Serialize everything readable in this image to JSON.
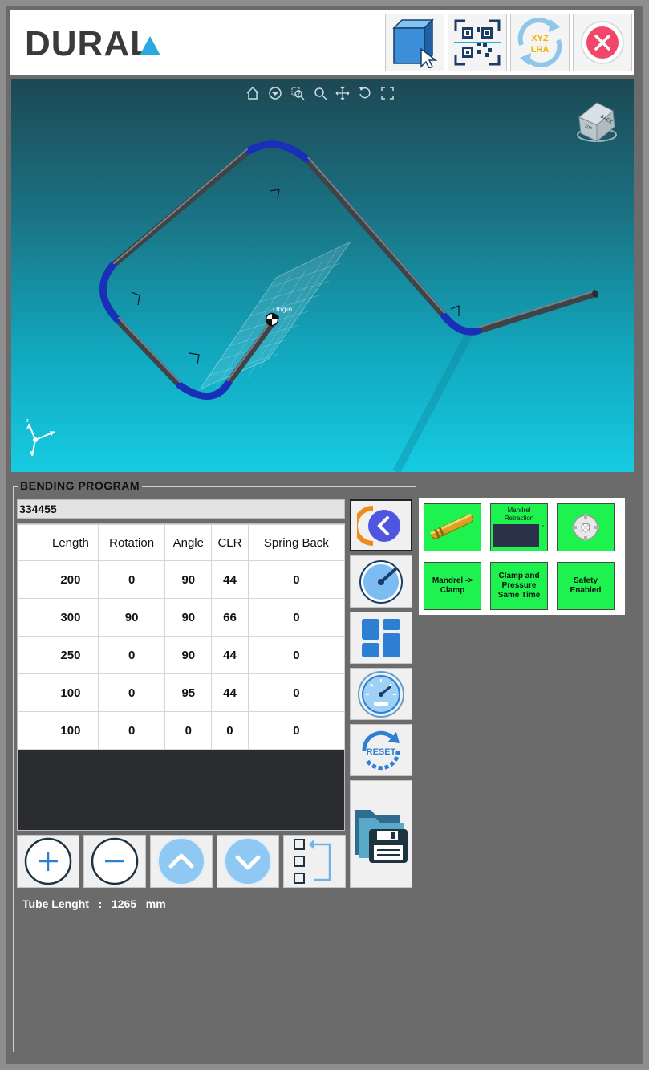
{
  "header": {
    "logo_text": "DURAL",
    "buttons": [
      {
        "name": "3d-view-button",
        "icon": "cube-cursor-icon"
      },
      {
        "name": "qr-scan-button",
        "icon": "qr-code-icon"
      },
      {
        "name": "xyz-lra-button",
        "icon": "xyz-lra-convert-icon",
        "label_top": "XYZ",
        "label_bottom": "LRA"
      },
      {
        "name": "close-button",
        "icon": "close-icon"
      }
    ]
  },
  "viewport": {
    "origin_label": "Origin",
    "cube_labels": {
      "top": "BACK",
      "side": "TOP"
    }
  },
  "program": {
    "title": "BENDING PROGRAM",
    "name": "334455",
    "columns": [
      "Length",
      "Rotation",
      "Angle",
      "CLR",
      "Spring Back"
    ],
    "rows": [
      [
        "200",
        "0",
        "90",
        "44",
        "0"
      ],
      [
        "300",
        "90",
        "90",
        "66",
        "0"
      ],
      [
        "250",
        "0",
        "90",
        "44",
        "0"
      ],
      [
        "100",
        "0",
        "95",
        "44",
        "0"
      ],
      [
        "100",
        "0",
        "0",
        "0",
        "0"
      ]
    ],
    "tube_length_label": "Tube Lenght",
    "tube_length_sep": ":",
    "tube_length_value": "1265",
    "tube_length_unit": "mm",
    "reset_label": "RESET"
  },
  "status": {
    "mandrel_retraction": "Mandrel Retraction",
    "mandrel_retraction_unit": "°",
    "mandrel_clamp": "Mandrel -> Clamp",
    "clamp_pressure": "Clamp and Pressure Same Time",
    "safety": "Safety Enabled"
  },
  "colors": {
    "status_green": "#1df24e",
    "accent_blue": "#2c7fd3",
    "accent_orange": "#f08a1c",
    "close_red": "#f2476a"
  }
}
